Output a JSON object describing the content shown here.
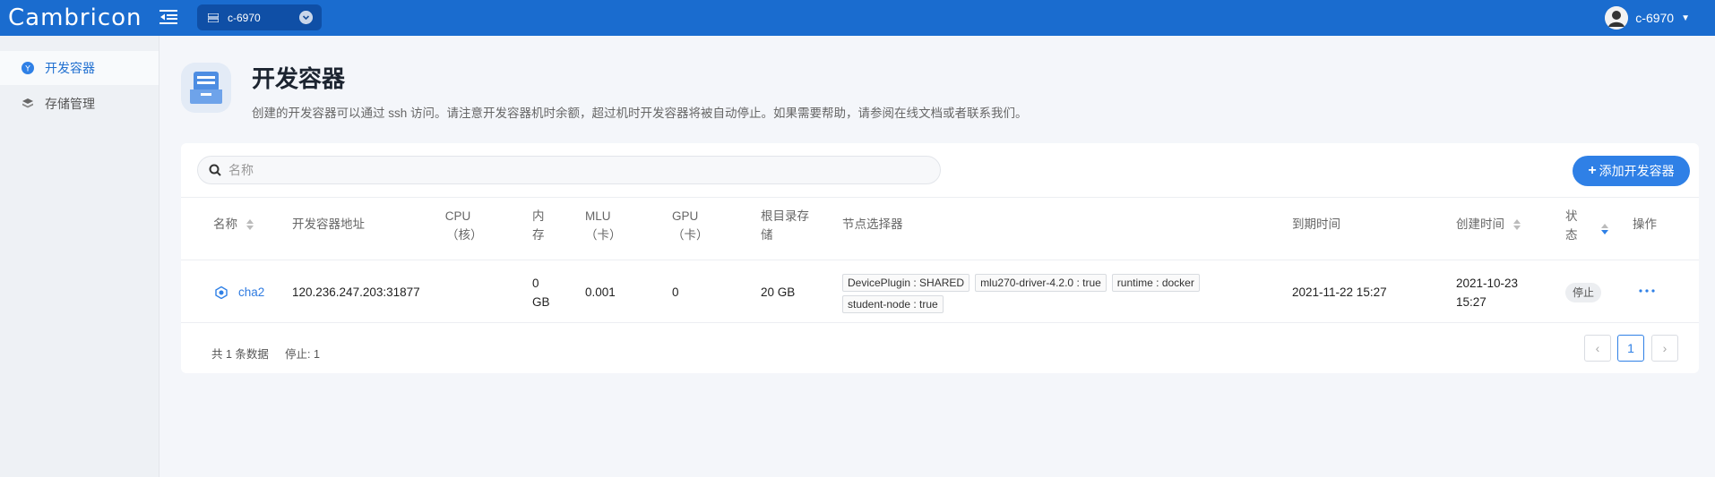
{
  "header": {
    "logo_text": "Cambricon",
    "cluster": "c-6970",
    "user_name": "c-6970"
  },
  "sidebar": {
    "items": [
      {
        "label": "开发容器",
        "icon": "container-icon",
        "active": true
      },
      {
        "label": "存储管理",
        "icon": "storage-icon",
        "active": false
      }
    ]
  },
  "page": {
    "title": "开发容器",
    "description": "创建的开发容器可以通过 ssh 访问。请注意开发容器机时余额，超过机时开发容器将被自动停止。如果需要帮助，请参阅在线文档或者联系我们。"
  },
  "toolbar": {
    "search_placeholder": "名称",
    "add_button_label": "添加开发容器"
  },
  "table": {
    "columns": {
      "name": "名称",
      "address": "开发容器地址",
      "cpu_l1": "CPU",
      "cpu_l2": "（核）",
      "mem_l1": "内",
      "mem_l2": "存",
      "mlu_l1": "MLU",
      "mlu_l2": "（卡）",
      "gpu_l1": "GPU",
      "gpu_l2": "（卡）",
      "root_l1": "根目录存",
      "root_l2": "储",
      "node_selector": "节点选择器",
      "expire": "到期时间",
      "created": "创建时间",
      "status_l1": "状",
      "status_l2": "态",
      "actions": "操作"
    },
    "rows": [
      {
        "name": "cha2",
        "address": "120.236.247.203:31877",
        "cpu": "",
        "mem_l1": "0",
        "mem_l2": "GB",
        "mlu": "0.001",
        "gpu": "0",
        "root_storage": "20 GB",
        "tags": [
          "DevicePlugin : SHARED",
          "mlu270-driver-4.2.0 : true",
          "runtime : docker",
          "student-node : true"
        ],
        "expire": "2021-11-22 15:27",
        "created_l1": "2021-10-23",
        "created_l2": "15:27",
        "status": "停止"
      }
    ]
  },
  "footer": {
    "total": "共 1 条数据",
    "stopped": "停止: 1",
    "current_page": "1",
    "prev": "‹",
    "next": "›"
  },
  "colors": {
    "topbar": "#1a6ccf",
    "accent": "#2f80e6"
  }
}
